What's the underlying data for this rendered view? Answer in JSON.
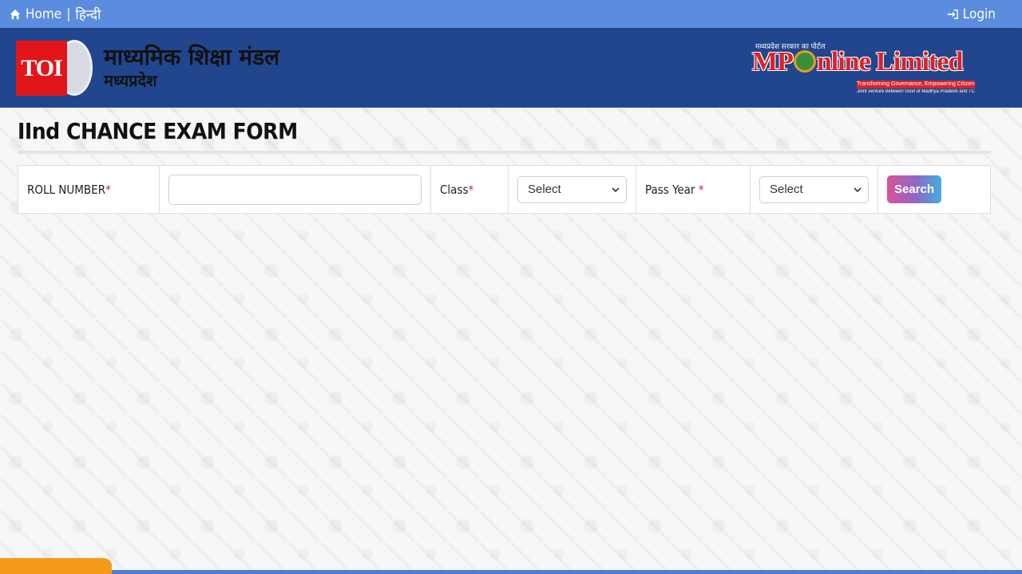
{
  "topbar": {
    "home_label": "Home",
    "separator": "|",
    "hindi_label": "हिन्दी",
    "login_label": "Login"
  },
  "header": {
    "badge_text": "TOI",
    "org_name_line1": "माध्यमिक शिक्षा मंडल",
    "org_name_line2": "मध्यप्रदेश",
    "partner": {
      "tagline": "मध्यप्रदेश सरकार का पोर्टल",
      "name_prefix": "MP",
      "name_suffix": "nline Limited",
      "subtitle": "Transforming Governance, Empowering Citizens",
      "jv_text": "Joint venture between Govt of Madhya Pradesh and TCS"
    }
  },
  "page_title": "IInd CHANCE EXAM FORM",
  "form": {
    "roll_label": "ROLL NUMBER",
    "roll_value": "",
    "roll_placeholder": "",
    "class_label": "Class",
    "class_selected": "Select",
    "pass_year_label": "Pass Year ",
    "pass_year_selected": "Select",
    "required_mark": "*",
    "search_label": "Search"
  },
  "colors": {
    "topbar": "#5a8bdd",
    "header": "#22468d",
    "required": "#e0242b",
    "toi_red": "#e2161a"
  }
}
